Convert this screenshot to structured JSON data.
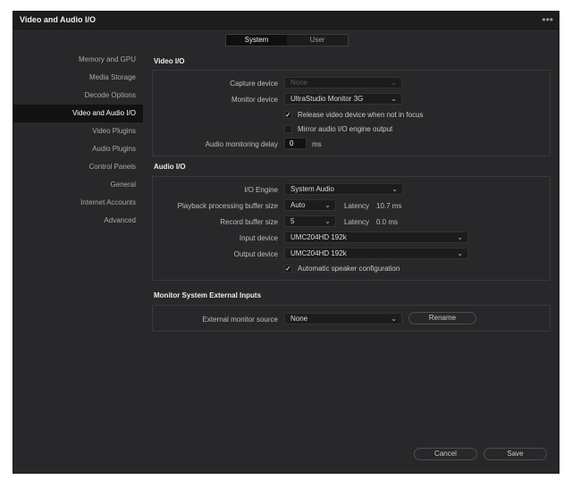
{
  "window": {
    "title": "Video and Audio I/O",
    "menu_icon": "more-horizontal-icon"
  },
  "tabs": [
    {
      "label": "System",
      "active": true
    },
    {
      "label": "User",
      "active": false
    }
  ],
  "sidebar": {
    "items": [
      {
        "label": "Memory and GPU"
      },
      {
        "label": "Media Storage"
      },
      {
        "label": "Decode Options"
      },
      {
        "label": "Video and Audio I/O",
        "active": true
      },
      {
        "label": "Video Plugins"
      },
      {
        "label": "Audio Plugins"
      },
      {
        "label": "Control Panels"
      },
      {
        "label": "General"
      },
      {
        "label": "Internet Accounts"
      },
      {
        "label": "Advanced"
      }
    ]
  },
  "video_io": {
    "title": "Video I/O",
    "capture_device": {
      "label": "Capture device",
      "value": "None",
      "disabled": true
    },
    "monitor_device": {
      "label": "Monitor device",
      "value": "UltraStudio Monitor 3G"
    },
    "release_device": {
      "label": "Release video device when not in focus",
      "checked": true
    },
    "mirror_audio": {
      "label": "Mirror audio I/O engine output",
      "checked": false
    },
    "monitoring_delay": {
      "label": "Audio monitoring delay",
      "value": "0",
      "unit": "ms"
    }
  },
  "audio_io": {
    "title": "Audio I/O",
    "io_engine": {
      "label": "I/O Engine",
      "value": "System Audio"
    },
    "playback_buffer": {
      "label": "Playback processing buffer size",
      "value": "Auto",
      "latency_label": "Latency",
      "latency_value": "10.7 ms"
    },
    "record_buffer": {
      "label": "Record buffer size",
      "value": "5",
      "latency_label": "Latency",
      "latency_value": "0.0 ms"
    },
    "input_device": {
      "label": "Input device",
      "value": "UMC204HD 192k"
    },
    "output_device": {
      "label": "Output device",
      "value": "UMC204HD 192k"
    },
    "auto_speaker": {
      "label": "Automatic speaker configuration",
      "checked": true
    }
  },
  "monitor_inputs": {
    "title": "Monitor System External Inputs",
    "source": {
      "label": "External monitor source",
      "value": "None"
    },
    "rename_label": "Rename"
  },
  "footer": {
    "cancel_label": "Cancel",
    "save_label": "Save"
  },
  "colors": {
    "window_bg": "#28282a",
    "titlebar_bg": "#1d1d1e",
    "active_item_bg": "#121213"
  }
}
